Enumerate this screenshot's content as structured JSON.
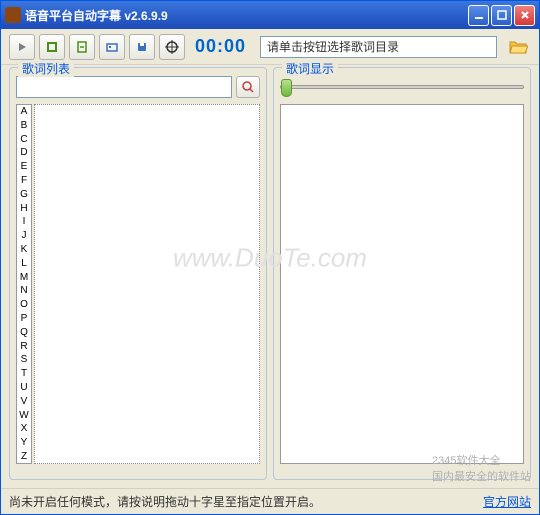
{
  "window": {
    "title": "语音平台自动字幕  v2.6.9.9"
  },
  "toolbar": {
    "time": "00:00",
    "path_placeholder": "请单击按钮选择歌词目录"
  },
  "panels": {
    "left_title": "歌词列表",
    "right_title": "歌词显示"
  },
  "alpha_index": [
    "A",
    "B",
    "C",
    "D",
    "E",
    "F",
    "G",
    "H",
    "I",
    "J",
    "K",
    "L",
    "M",
    "N",
    "O",
    "P",
    "Q",
    "R",
    "S",
    "T",
    "U",
    "V",
    "W",
    "X",
    "Y",
    "Z"
  ],
  "status": {
    "text": "尚未开启任何模式，请按说明拖动十字星至指定位置开启。",
    "link": "官方网站"
  },
  "watermark": "www.DuoTe.com",
  "logo": {
    "line1": "2345软件大全",
    "line2": "国内最安全的软件站"
  }
}
